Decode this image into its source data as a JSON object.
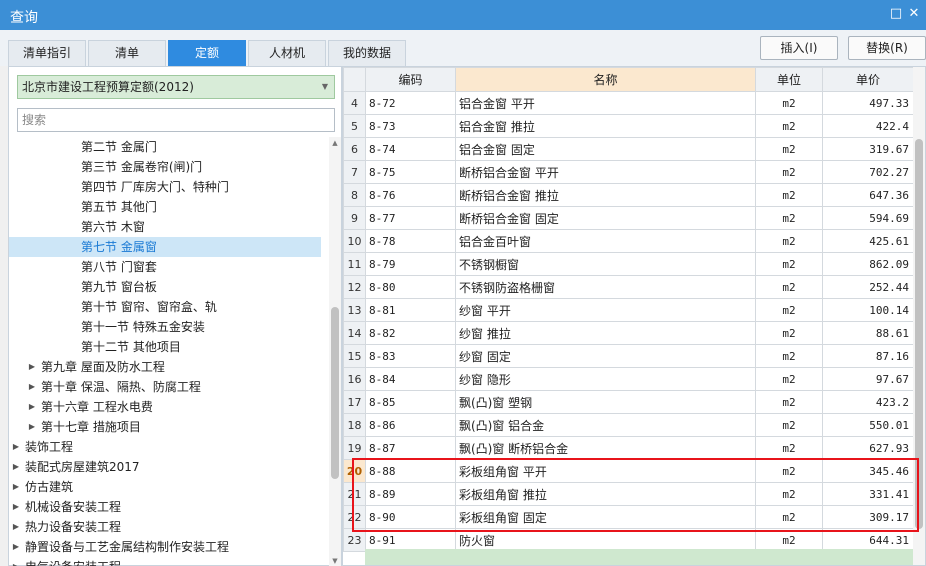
{
  "window": {
    "title": "查询"
  },
  "tabs": [
    {
      "label": "清单指引",
      "active": false
    },
    {
      "label": "清单",
      "active": false
    },
    {
      "label": "定额",
      "active": true
    },
    {
      "label": "人材机",
      "active": false
    },
    {
      "label": "我的数据",
      "active": false
    }
  ],
  "toolbar": {
    "insert_label": "插入(I)",
    "replace_label": "替换(R)"
  },
  "left": {
    "library": "北京市建设工程预算定额(2012)",
    "search_placeholder": "搜索",
    "tree": [
      {
        "label": "第二节 金属门",
        "level": 3,
        "caret": false,
        "selected": false
      },
      {
        "label": "第三节 金属卷帘(闸)门",
        "level": 3,
        "caret": false,
        "selected": false
      },
      {
        "label": "第四节 厂库房大门、特种门",
        "level": 3,
        "caret": false,
        "selected": false
      },
      {
        "label": "第五节 其他门",
        "level": 3,
        "caret": false,
        "selected": false
      },
      {
        "label": "第六节 木窗",
        "level": 3,
        "caret": false,
        "selected": false
      },
      {
        "label": "第七节 金属窗",
        "level": 3,
        "caret": false,
        "selected": true
      },
      {
        "label": "第八节 门窗套",
        "level": 3,
        "caret": false,
        "selected": false
      },
      {
        "label": "第九节 窗台板",
        "level": 3,
        "caret": false,
        "selected": false
      },
      {
        "label": "第十节 窗帘、窗帘盒、轨",
        "level": 3,
        "caret": false,
        "selected": false
      },
      {
        "label": "第十一节 特殊五金安装",
        "level": 3,
        "caret": false,
        "selected": false
      },
      {
        "label": "第十二节 其他项目",
        "level": 3,
        "caret": false,
        "selected": false
      },
      {
        "label": "第九章 屋面及防水工程",
        "level": 2,
        "caret": true,
        "selected": false
      },
      {
        "label": "第十章 保温、隔热、防腐工程",
        "level": 2,
        "caret": true,
        "selected": false
      },
      {
        "label": "第十六章 工程水电费",
        "level": 2,
        "caret": true,
        "selected": false
      },
      {
        "label": "第十七章 措施项目",
        "level": 2,
        "caret": true,
        "selected": false
      },
      {
        "label": "装饰工程",
        "level": 1,
        "caret": true,
        "selected": false
      },
      {
        "label": "装配式房屋建筑2017",
        "level": 1,
        "caret": true,
        "selected": false
      },
      {
        "label": "仿古建筑",
        "level": 1,
        "caret": true,
        "selected": false
      },
      {
        "label": "机械设备安装工程",
        "level": 1,
        "caret": true,
        "selected": false
      },
      {
        "label": "热力设备安装工程",
        "level": 1,
        "caret": true,
        "selected": false
      },
      {
        "label": "静置设备与工艺金属结构制作安装工程",
        "level": 1,
        "caret": true,
        "selected": false
      },
      {
        "label": "电气设备安装工程",
        "level": 1,
        "caret": true,
        "selected": false
      }
    ]
  },
  "grid": {
    "columns": [
      "编码",
      "名称",
      "单位",
      "单价"
    ],
    "rows": [
      {
        "num": "4",
        "code": "8-72",
        "name": "铝合金窗 平开",
        "unit": "m2",
        "price": "497.33"
      },
      {
        "num": "5",
        "code": "8-73",
        "name": "铝合金窗 推拉",
        "unit": "m2",
        "price": "422.4"
      },
      {
        "num": "6",
        "code": "8-74",
        "name": "铝合金窗 固定",
        "unit": "m2",
        "price": "319.67"
      },
      {
        "num": "7",
        "code": "8-75",
        "name": "断桥铝合金窗 平开",
        "unit": "m2",
        "price": "702.27"
      },
      {
        "num": "8",
        "code": "8-76",
        "name": "断桥铝合金窗 推拉",
        "unit": "m2",
        "price": "647.36"
      },
      {
        "num": "9",
        "code": "8-77",
        "name": "断桥铝合金窗 固定",
        "unit": "m2",
        "price": "594.69"
      },
      {
        "num": "10",
        "code": "8-78",
        "name": "铝合金百叶窗",
        "unit": "m2",
        "price": "425.61"
      },
      {
        "num": "11",
        "code": "8-79",
        "name": "不锈钢橱窗",
        "unit": "m2",
        "price": "862.09"
      },
      {
        "num": "12",
        "code": "8-80",
        "name": "不锈钢防盗格栅窗",
        "unit": "m2",
        "price": "252.44"
      },
      {
        "num": "13",
        "code": "8-81",
        "name": "纱窗 平开",
        "unit": "m2",
        "price": "100.14"
      },
      {
        "num": "14",
        "code": "8-82",
        "name": "纱窗 推拉",
        "unit": "m2",
        "price": "88.61"
      },
      {
        "num": "15",
        "code": "8-83",
        "name": "纱窗 固定",
        "unit": "m2",
        "price": "87.16"
      },
      {
        "num": "16",
        "code": "8-84",
        "name": "纱窗 隐形",
        "unit": "m2",
        "price": "97.67"
      },
      {
        "num": "17",
        "code": "8-85",
        "name": "飘(凸)窗 塑钢",
        "unit": "m2",
        "price": "423.2"
      },
      {
        "num": "18",
        "code": "8-86",
        "name": "飘(凸)窗 铝合金",
        "unit": "m2",
        "price": "550.01"
      },
      {
        "num": "19",
        "code": "8-87",
        "name": "飘(凸)窗 断桥铝合金",
        "unit": "m2",
        "price": "627.93"
      },
      {
        "num": "20",
        "code": "8-88",
        "name": "彩板组角窗 平开",
        "unit": "m2",
        "price": "345.46"
      },
      {
        "num": "21",
        "code": "8-89",
        "name": "彩板组角窗 推拉",
        "unit": "m2",
        "price": "331.41"
      },
      {
        "num": "22",
        "code": "8-90",
        "name": "彩板组角窗 固定",
        "unit": "m2",
        "price": "309.17"
      },
      {
        "num": "23",
        "code": "8-91",
        "name": "防火窗",
        "unit": "m2",
        "price": "644.31"
      }
    ],
    "highlight_num": "20"
  },
  "colors": {
    "titlebar": "#3c8fd6",
    "active_tab": "#2f8be0",
    "selected_tree": "#cde6f7",
    "annotation": "#e8141b"
  }
}
